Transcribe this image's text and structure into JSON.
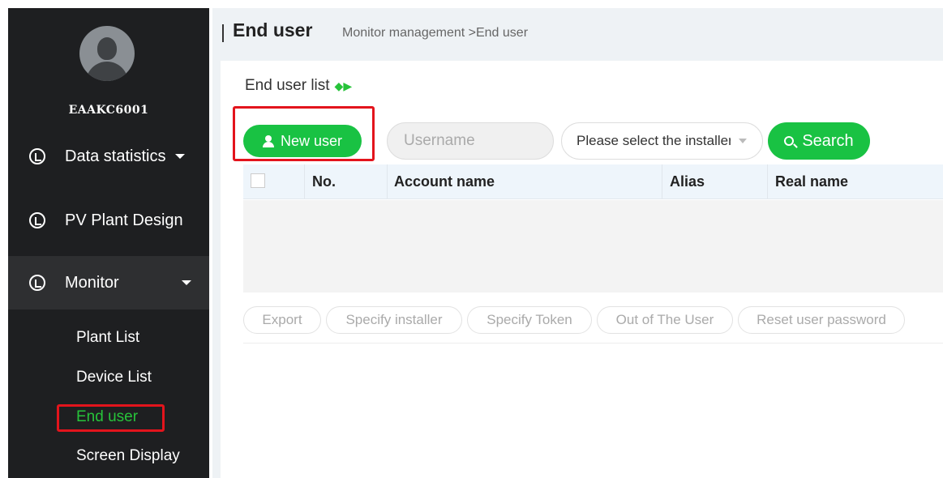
{
  "sidebar": {
    "username": "EAAKC6001",
    "nav": {
      "data_statistics": "Data statistics",
      "pv_plant_design": "PV Plant Design",
      "monitor": "Monitor"
    },
    "sub_items": {
      "plant_list": "Plant List",
      "device_list": "Device List",
      "end_user": "End user",
      "screen_display": "Screen Display"
    }
  },
  "header": {
    "title": "End user",
    "breadcrumb": "Monitor management >End user"
  },
  "panel": {
    "list_title": "End user list",
    "new_user_label": "New user",
    "username_placeholder": "Username",
    "installer_select": "Please select the installer",
    "search_label": "Search"
  },
  "table": {
    "columns": [
      "No.",
      "Account name",
      "Alias",
      "Real name"
    ]
  },
  "actions": [
    "Export",
    "Specify installer",
    "Specify Token",
    "Out of The User",
    "Reset user password"
  ],
  "colors": {
    "accent_green": "#19c243",
    "highlight_red": "#e3141c",
    "sidebar_bg": "#1e1f21"
  }
}
